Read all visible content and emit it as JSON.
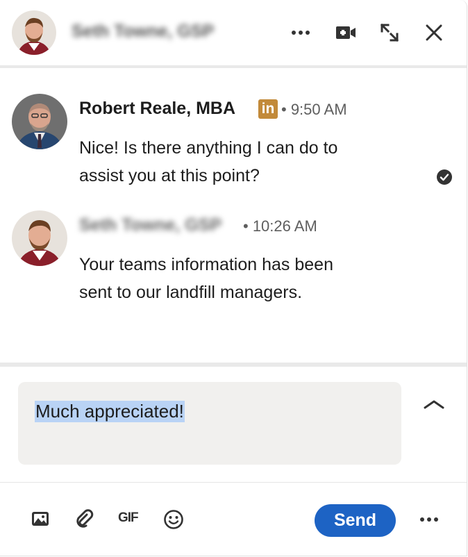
{
  "header": {
    "contact_name": "Seth Towne, GSP"
  },
  "messages": [
    {
      "sender": "Robert Reale, MBA",
      "badge": "in",
      "time": "• 9:50 AM",
      "lines": [
        "Nice! Is there anything I can do to",
        "assist you at this point?"
      ],
      "status_icon": "read-receipt-check-icon"
    },
    {
      "sender": "Seth Towne, GSP",
      "time": "• 10:26 AM",
      "lines": [
        "Your teams information has been",
        "sent to our landfill managers."
      ]
    }
  ],
  "compose": {
    "text": "Much appreciated!"
  },
  "toolbar": {
    "gif_label": "GIF",
    "send_label": "Send",
    "icons": [
      "image-icon",
      "paperclip-icon",
      "gif-icon",
      "emoji-icon",
      "more-options-icon"
    ]
  },
  "colors": {
    "send_button": "#1d63c4",
    "linkedin_badge": "#c28a3a",
    "selection_highlight": "#b9d3f5",
    "compose_background": "#f1f0ee"
  }
}
